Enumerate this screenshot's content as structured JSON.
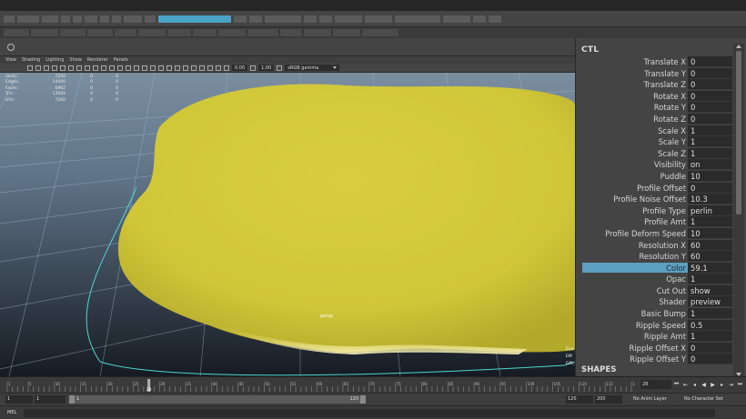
{
  "viewport": {
    "menu": [
      "View",
      "Shading",
      "Lighting",
      "Show",
      "Renderer",
      "Panels"
    ],
    "toolbar": {
      "exposure": "0.00",
      "gamma": "1.00",
      "color_space": "sRGB gamma"
    },
    "hud": [
      {
        "label": "Verts:",
        "v1": "7250",
        "v2": "0",
        "v3": "0"
      },
      {
        "label": "Edges:",
        "v1": "14400",
        "v2": "0",
        "v3": "0"
      },
      {
        "label": "Faces:",
        "v1": "6962",
        "v2": "0",
        "v3": "0"
      },
      {
        "label": "Tris:",
        "v1": "13924",
        "v2": "0",
        "v3": "0"
      },
      {
        "label": "UVs:",
        "v1": "7260",
        "v2": "0",
        "v3": "0"
      }
    ],
    "camera_label": "persp",
    "hud_right": [
      "Eva",
      "EM",
      "GPL"
    ]
  },
  "channel_box": {
    "title": "CTL",
    "attributes": [
      {
        "name": "Translate X",
        "value": "0"
      },
      {
        "name": "Translate Y",
        "value": "0"
      },
      {
        "name": "Translate Z",
        "value": "0"
      },
      {
        "name": "Rotate X",
        "value": "0"
      },
      {
        "name": "Rotate Y",
        "value": "0"
      },
      {
        "name": "Rotate Z",
        "value": "0"
      },
      {
        "name": "Scale X",
        "value": "1"
      },
      {
        "name": "Scale Y",
        "value": "1"
      },
      {
        "name": "Scale Z",
        "value": "1"
      },
      {
        "name": "Visibility",
        "value": "on"
      },
      {
        "name": "Puddle",
        "value": "10"
      },
      {
        "name": "Profile Offset",
        "value": "0"
      },
      {
        "name": "Profile Noise Offset",
        "value": "10.3"
      },
      {
        "name": "Profile Type",
        "value": "perlin"
      },
      {
        "name": "Profile Amt",
        "value": "1"
      },
      {
        "name": "Profile Deform Speed",
        "value": "10"
      },
      {
        "name": "Resolution X",
        "value": "60"
      },
      {
        "name": "Resolution Y",
        "value": "60"
      },
      {
        "name": "Color",
        "value": "59.1",
        "selected": true
      },
      {
        "name": "Opac",
        "value": "1"
      },
      {
        "name": "Cut Out",
        "value": "show"
      },
      {
        "name": "Shader",
        "value": "preview"
      },
      {
        "name": "Basic Bump",
        "value": "1"
      },
      {
        "name": "Ripple Speed",
        "value": "0.5"
      },
      {
        "name": "Ripple Amt",
        "value": "1"
      },
      {
        "name": "Ripple Offset X",
        "value": "0"
      },
      {
        "name": "Ripple Offset Y",
        "value": "0"
      }
    ],
    "shapes_header": "SHAPES"
  },
  "timeline": {
    "ticks": [
      "1",
      "5",
      "10",
      "15",
      "20",
      "25",
      "30",
      "35",
      "40",
      "45",
      "50",
      "55",
      "60",
      "65",
      "70",
      "75",
      "80",
      "85",
      "90",
      "95",
      "100",
      "105",
      "110",
      "115",
      "120"
    ],
    "current_frame_marker": "28",
    "current_frame_field": "28"
  },
  "range": {
    "start": "1",
    "start_inner": "1",
    "bar_start": "1",
    "bar_end": "120",
    "end_inner": "120",
    "end": "200",
    "anim_layer": "No Anim Layer",
    "char_set": "No Character Set"
  },
  "cmdline": {
    "mode": "MEL"
  },
  "colors": {
    "highlight": "#5c9fc0",
    "puddle": "#d2c83a",
    "grid": "#9bb6c8",
    "outline": "#4fd6d0"
  }
}
